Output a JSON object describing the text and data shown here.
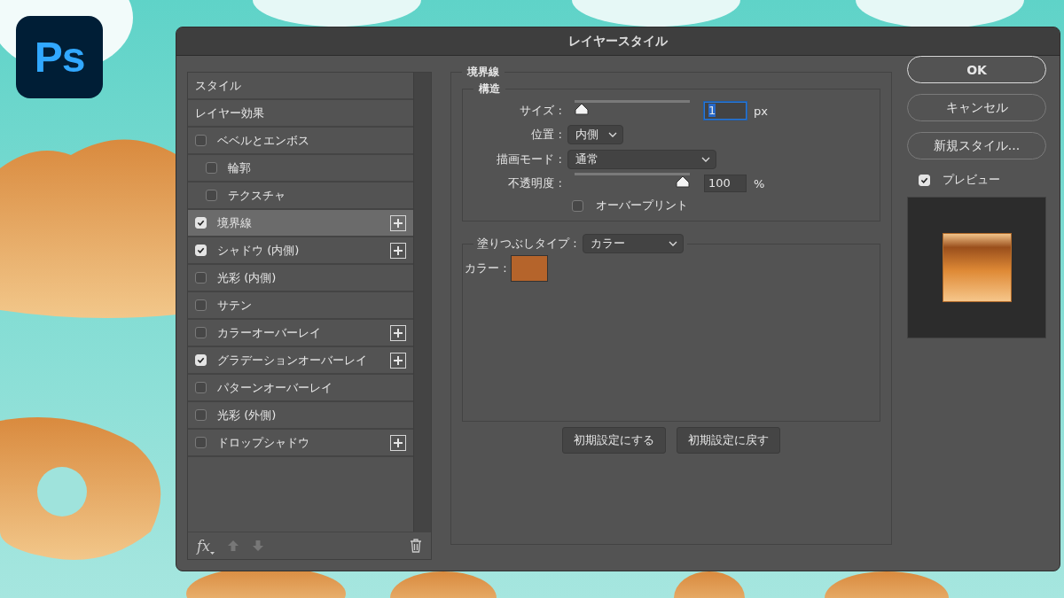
{
  "app_logo": "Ps",
  "dialog": {
    "title": "レイヤースタイル"
  },
  "styles_list": {
    "items": [
      {
        "kind": "header",
        "label": "スタイル"
      },
      {
        "kind": "header",
        "label": "レイヤー効果"
      },
      {
        "kind": "effect",
        "label": "ベベルとエンボス",
        "checked": false,
        "selected": false,
        "add_button": false,
        "children": [
          {
            "kind": "effect",
            "label": "輪郭",
            "checked": false,
            "selected": false,
            "add_button": false
          },
          {
            "kind": "effect",
            "label": "テクスチャ",
            "checked": false,
            "selected": false,
            "add_button": false
          }
        ]
      },
      {
        "kind": "effect",
        "label": "境界線",
        "checked": true,
        "selected": true,
        "add_button": true
      },
      {
        "kind": "effect",
        "label": "シャドウ (内側)",
        "checked": true,
        "selected": false,
        "add_button": true
      },
      {
        "kind": "effect",
        "label": "光彩 (内側)",
        "checked": false,
        "selected": false,
        "add_button": false
      },
      {
        "kind": "effect",
        "label": "サテン",
        "checked": false,
        "selected": false,
        "add_button": false
      },
      {
        "kind": "effect",
        "label": "カラーオーバーレイ",
        "checked": false,
        "selected": false,
        "add_button": true
      },
      {
        "kind": "effect",
        "label": "グラデーションオーバーレイ",
        "checked": true,
        "selected": false,
        "add_button": true
      },
      {
        "kind": "effect",
        "label": "パターンオーバーレイ",
        "checked": false,
        "selected": false,
        "add_button": false
      },
      {
        "kind": "effect",
        "label": "光彩 (外側)",
        "checked": false,
        "selected": false,
        "add_button": false
      },
      {
        "kind": "effect",
        "label": "ドロップシャドウ",
        "checked": false,
        "selected": false,
        "add_button": true
      }
    ],
    "toolbar": {
      "fx_label": "fx",
      "move_disabled": true
    }
  },
  "stroke_panel": {
    "title": "境界線",
    "structure": {
      "title": "構造",
      "size": {
        "label": "サイズ :",
        "level": 0,
        "value": "1",
        "unit": "px"
      },
      "position": {
        "label": "位置 :",
        "value": "内側"
      },
      "blend_mode": {
        "label": "描画モード :",
        "value": "通常"
      },
      "opacity": {
        "label": "不透明度 :",
        "level": 1,
        "value": "100",
        "unit": "%"
      },
      "overprint": {
        "label": "オーバープリント",
        "checked": false
      }
    },
    "fill": {
      "label": "塗りつぶしタイプ :",
      "value": "カラー",
      "color_label": "カラー :",
      "color": "#b5642b"
    },
    "buttons": [
      "初期設定にする",
      "初期設定に戻す"
    ]
  },
  "side": {
    "buttons": [
      {
        "label": "OK",
        "kind": "default"
      },
      {
        "label": "キャンセル",
        "kind": "normal"
      },
      {
        "label": "新規スタイル...",
        "kind": "normal"
      }
    ],
    "preview": {
      "label": "プレビュー",
      "checked": true
    }
  }
}
